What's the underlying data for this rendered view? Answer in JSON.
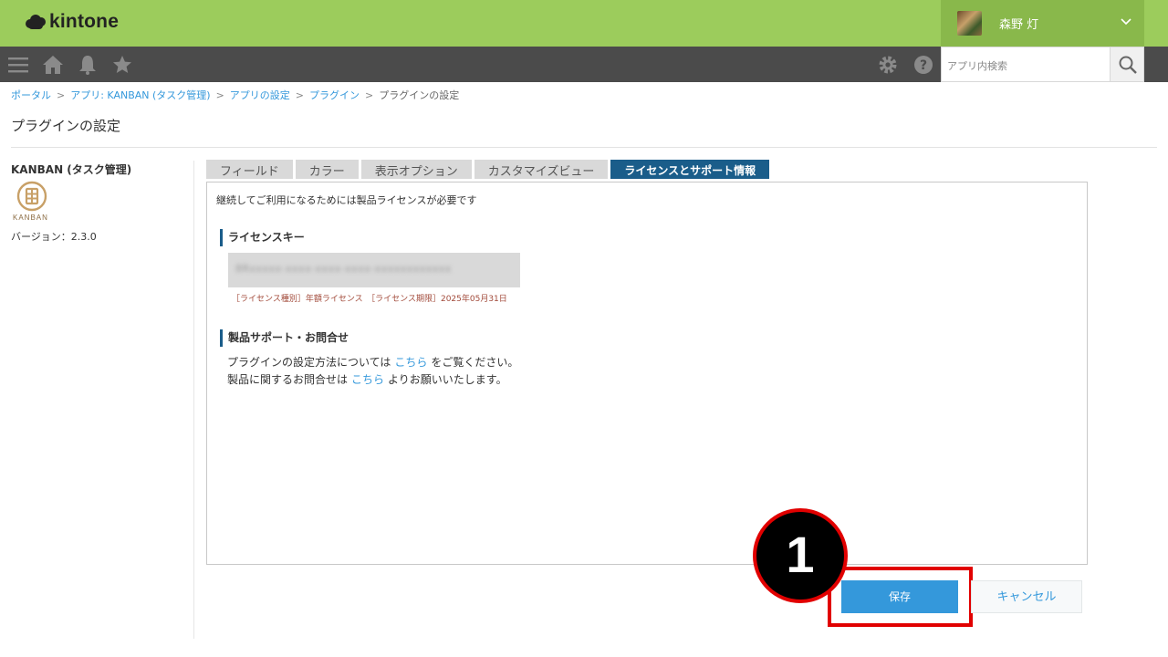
{
  "header": {
    "logo_text": "kintone",
    "user_name": "森野 灯"
  },
  "nav": {
    "search_placeholder": "アプリ内検索"
  },
  "breadcrumb": {
    "items": [
      "ポータル",
      "アプリ: KANBAN (タスク管理)",
      "アプリの設定",
      "プラグイン",
      "プラグインの設定"
    ],
    "separator": ">"
  },
  "page": {
    "title": "プラグインの設定"
  },
  "plugin": {
    "name": "KANBAN (タスク管理)",
    "logo_text": "KANBAN",
    "version": "バージョン：2.3.0"
  },
  "tabs": [
    {
      "label": "フィールド",
      "active": false
    },
    {
      "label": "カラー",
      "active": false
    },
    {
      "label": "表示オプション",
      "active": false
    },
    {
      "label": "カスタマイズビュー",
      "active": false
    },
    {
      "label": "ライセンスとサポート情報",
      "active": true
    }
  ],
  "content": {
    "notice": "継続してご利用になるためには製品ライセンスが必要です",
    "license_heading": "ライセンスキー",
    "license_key": "8Rxxxxx-xxxx-xxxx-xxxx-xxxxxxxxxxxx",
    "license_info": "［ライセンス種別］年額ライセンス　［ライセンス期限］2025年05月31日",
    "support_heading": "製品サポート・お問合せ",
    "support_line1_pre": "プラグインの設定方法については",
    "support_line1_link": "こちら",
    "support_line1_post": "をご覧ください。",
    "support_line2_pre": "製品に関するお問合せは",
    "support_line2_link": "こちら",
    "support_line2_post": "よりお願いいたします。"
  },
  "actions": {
    "save_label": "保存",
    "cancel_label": "キャンセル"
  },
  "annotation": {
    "step_number": "1"
  },
  "colors": {
    "header_green": "#9ccc5c",
    "nav_dark": "#4b4b4b",
    "tab_active": "#1a5d8a",
    "link_blue": "#3498db",
    "save_blue": "#3498db",
    "highlight_red": "#e10000"
  }
}
